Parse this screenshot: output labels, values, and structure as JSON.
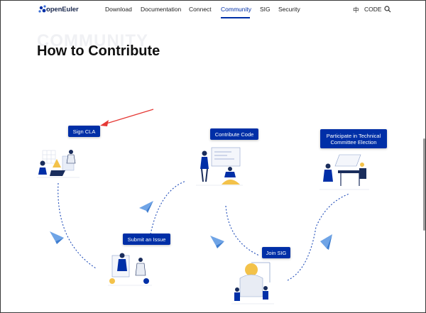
{
  "nav": {
    "logo_text": "openEuler",
    "items": [
      {
        "label": "Download",
        "active": false
      },
      {
        "label": "Documentation",
        "active": false
      },
      {
        "label": "Connect",
        "active": false
      },
      {
        "label": "Community",
        "active": true
      },
      {
        "label": "SIG",
        "active": false
      },
      {
        "label": "Security",
        "active": false
      }
    ],
    "language_icon_text": "中",
    "code_label": "CODE"
  },
  "page": {
    "background_title": "COMMUNITY",
    "title": "How to Contribute"
  },
  "steps": {
    "sign_cla": "Sign CLA",
    "contribute_code": "Contribute Code",
    "participate": "Participate in Technical Committee Election",
    "submit_issue": "Submit an Issue",
    "join_sig": "Join SIG"
  },
  "colors": {
    "accent": "#002fa7",
    "annotation_arrow": "#e53935",
    "dotted_path": "#1e4bb8",
    "plane": "#6fa4e6"
  }
}
